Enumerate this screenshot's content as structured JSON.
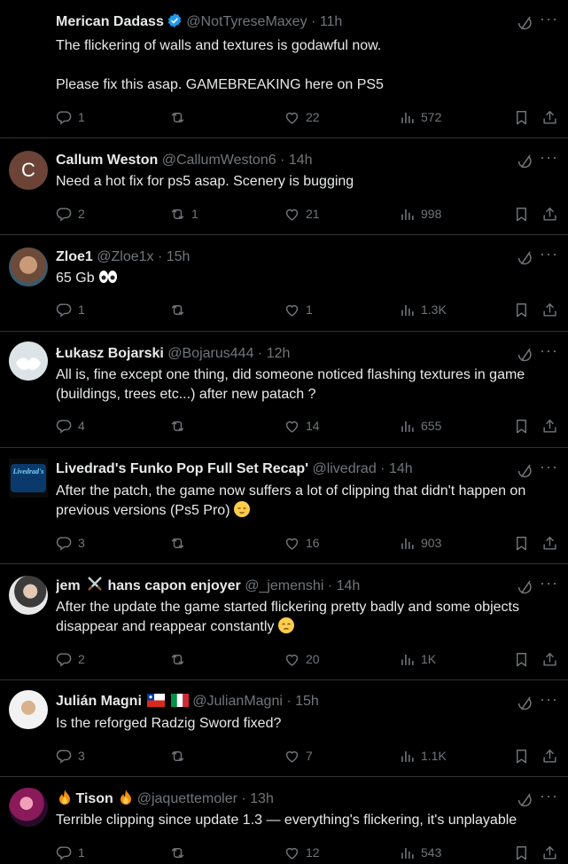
{
  "tweets": [
    {
      "name": "Merican Dadass",
      "handle": "@NotTyreseMaxey",
      "time": "11h",
      "text": "The flickering of walls and textures is godawful now.\n\nPlease fix this asap. GAMEBREAKING here on PS5",
      "replies": "1",
      "retweets": "",
      "likes": "22",
      "views": "572",
      "verified": true
    },
    {
      "name": "Callum Weston",
      "handle": "@CallumWeston6",
      "time": "14h",
      "text": "Need a hot fix for ps5 asap. Scenery is bugging",
      "replies": "2",
      "retweets": "1",
      "likes": "21",
      "views": "998",
      "avatar_letter": "C"
    },
    {
      "name": "Zloe1",
      "handle": "@Zloe1x",
      "time": "15h",
      "text": "65 Gb",
      "replies": "1",
      "retweets": "",
      "likes": "1",
      "views": "1.3K"
    },
    {
      "name": "Łukasz Bojarski",
      "handle": "@Bojarus444",
      "time": "12h",
      "text": "All is, fine except one thing, did someone noticed flashing textures in game (buildings, trees etc...) after new patach ?",
      "replies": "4",
      "retweets": "",
      "likes": "14",
      "views": "655"
    },
    {
      "name": "Livedrad's Funko Pop Full Set Recap'",
      "handle": "@livedrad",
      "time": "14h",
      "text": "After the patch, the game now suffers a lot of clipping that didn't happen on previous versions (Ps5 Pro)",
      "replies": "3",
      "retweets": "",
      "likes": "16",
      "views": "903",
      "avatar_text": "Livedrad's"
    },
    {
      "name": "jem",
      "name_suffix": "hans capon enjoyer",
      "handle": "@_jemenshi",
      "time": "14h",
      "text": "After the update the game started flickering pretty badly and some objects disappear and reappear constantly",
      "replies": "2",
      "retweets": "",
      "likes": "20",
      "views": "1K"
    },
    {
      "name": "Julián Magni",
      "handle": "@JulianMagni",
      "time": "15h",
      "text": "Is the reforged Radzig Sword fixed?",
      "replies": "3",
      "retweets": "",
      "likes": "7",
      "views": "1.1K"
    },
    {
      "name": "Tison",
      "handle": "@jaquettemoler",
      "time": "13h",
      "text": "Terrible clipping since update 1.3 — everything's flickering, it's unplayable",
      "replies": "1",
      "retweets": "",
      "likes": "12",
      "views": "543"
    }
  ],
  "separator": "·",
  "more_glyph": "···",
  "colors": {
    "background": "#000000",
    "text": "#e7e9ea",
    "muted": "#71767b",
    "border": "#2f3336",
    "verified": "#1d9bf0"
  }
}
